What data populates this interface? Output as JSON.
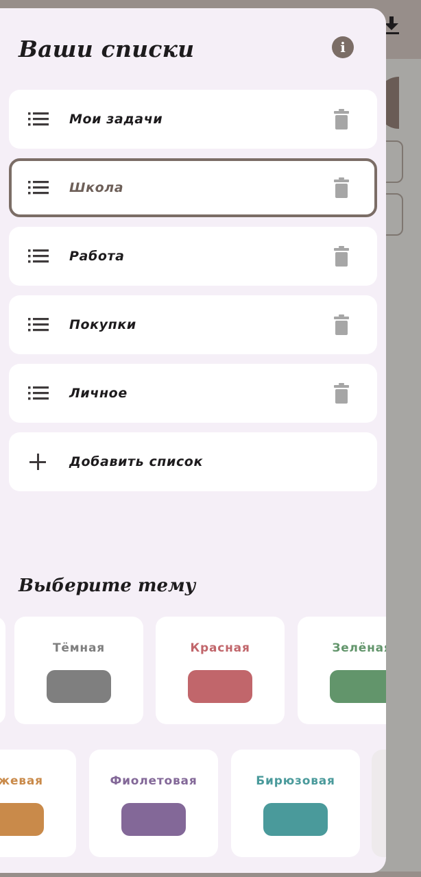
{
  "drawer": {
    "title": "Ваши списки",
    "info_icon": "info-icon",
    "lists": [
      {
        "label": "Мои задачи",
        "icon": "list-icon",
        "delete_icon": "trash-icon",
        "selected": false
      },
      {
        "label": "Школа",
        "icon": "list-icon",
        "delete_icon": "trash-icon",
        "selected": true
      },
      {
        "label": "Работа",
        "icon": "list-icon",
        "delete_icon": "trash-icon",
        "selected": false
      },
      {
        "label": "Покупки",
        "icon": "list-icon",
        "delete_icon": "trash-icon",
        "selected": false
      },
      {
        "label": "Личное",
        "icon": "list-icon",
        "delete_icon": "trash-icon",
        "selected": false
      }
    ],
    "add_list": {
      "label": "Добавить список",
      "icon": "plus-icon"
    }
  },
  "themes": {
    "title": "Выберите тему",
    "items": [
      {
        "label": "",
        "color": "#4a4a4a"
      },
      {
        "label": "Тёмная",
        "color": "#7f7f7f"
      },
      {
        "label": "Красная",
        "color": "#c1666b"
      },
      {
        "label": "Зелёная",
        "color": "#62956b"
      },
      {
        "label": "Бежевая",
        "color": "#c98a4a"
      },
      {
        "label": "Фиолетовая",
        "color": "#836898"
      },
      {
        "label": "Бирюзовая",
        "color": "#4a9a9b"
      }
    ]
  },
  "colors": {
    "accent": "#7b6d66",
    "drawer_bg": "#f5eff7",
    "scrim": "#a7a6a3"
  },
  "background": {
    "download_icon": "download-icon"
  }
}
